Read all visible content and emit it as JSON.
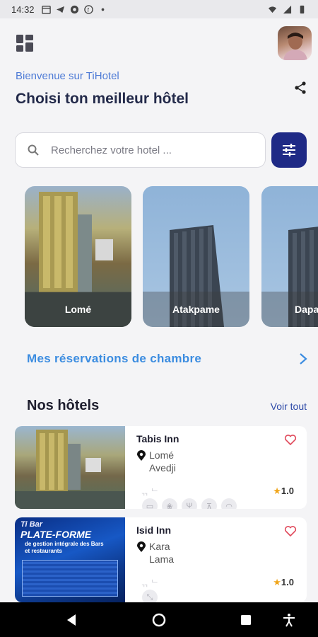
{
  "status_bar": {
    "time": "14:32",
    "left_icons": [
      "calendar-icon",
      "telegram-icon",
      "vpn-icon",
      "facebook-icon",
      "dot-icon"
    ],
    "right_icons": [
      "wifi-icon",
      "signal-icon",
      "battery-icon"
    ]
  },
  "header": {
    "welcome": "Bienvenue sur TiHotel",
    "title": "Choisi ton meilleur hôtel"
  },
  "search": {
    "placeholder": "Recherchez votre hotel ..."
  },
  "cities": [
    {
      "name": "Lomé"
    },
    {
      "name": "Atakpame"
    },
    {
      "name": "Dapa"
    }
  ],
  "reservations_link": "Mes réservations de chambre",
  "hotels_section": {
    "title": "Nos hôtels",
    "see_all": "Voir tout"
  },
  "hotels": [
    {
      "name": "Tabis Inn",
      "city": "Lomé",
      "district": "Avedji",
      "rating": "1.0",
      "faint": "ᆩ ᄂ"
    },
    {
      "name": "Isid Inn",
      "city": "Kara",
      "district": "Lama",
      "rating": "1.0",
      "faint": "ᆩ ᄂ",
      "promo_line1": "Ti Bar",
      "promo_line2": "PLATE-FORME",
      "promo_line3": "de gestion intégrale des Bars et restaurants"
    }
  ],
  "colors": {
    "accent_blue": "#3b8ce0",
    "filter_button": "#1f2a86",
    "welcome_text": "#4e7bd6",
    "heart": "#e0485a",
    "star": "#f0a51a"
  }
}
